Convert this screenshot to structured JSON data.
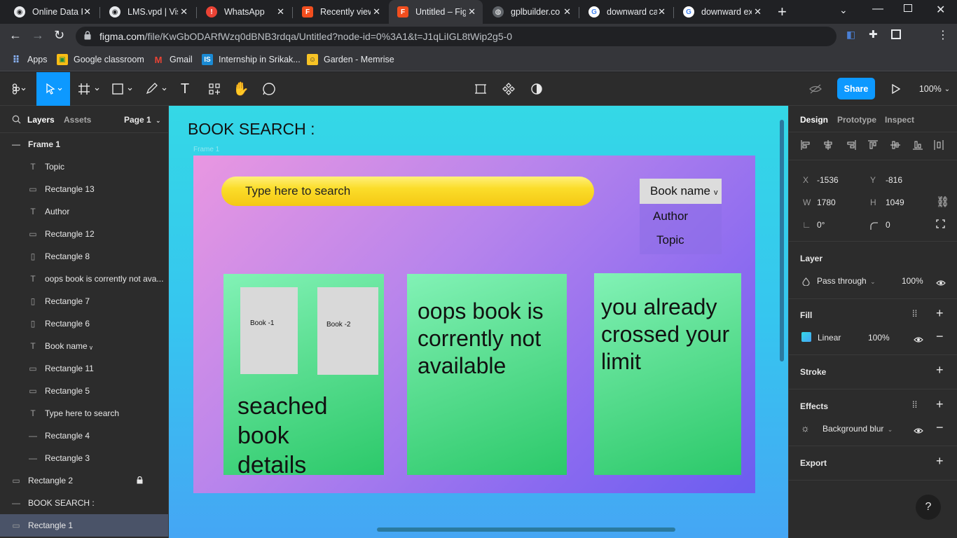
{
  "browser": {
    "tabs": [
      {
        "label": "Online Data F",
        "favicon_color": "#e8eaed"
      },
      {
        "label": "LMS.vpd | Vis",
        "favicon_color": "#e8eaed"
      },
      {
        "label": "WhatsApp",
        "favicon_color": "#ea4335"
      },
      {
        "label": "Recently view",
        "favicon_color": "#f24e1e"
      },
      {
        "label": "Untitled – Fig",
        "favicon_color": "#f24e1e"
      },
      {
        "label": "gplbuilder.co",
        "favicon_color": "#9aa0a6"
      },
      {
        "label": "downward ca",
        "favicon_color": "#4285f4"
      },
      {
        "label": "downward ex",
        "favicon_color": "#4285f4"
      }
    ],
    "new_tab_glyph": "+",
    "url_host": "figma.com",
    "url_path": "/file/KwGbODARfWzq0dBNB3rdqa/Untitled?node-id=0%3A1&t=J1qLiIGL8tWip2g5-0",
    "bookmarks": [
      {
        "label": "Apps",
        "icon": "apps-grid-icon"
      },
      {
        "label": "Google classroom",
        "icon": "classroom-icon"
      },
      {
        "label": "Gmail",
        "icon": "gmail-icon"
      },
      {
        "label": "Internship in Srikak...",
        "icon": "internshala-icon"
      },
      {
        "label": "Garden - Memrise",
        "icon": "memrise-icon"
      }
    ]
  },
  "figma": {
    "toolbar": {
      "share_label": "Share",
      "zoom_label": "100%"
    },
    "left_panel": {
      "tab_layers": "Layers",
      "tab_assets": "Assets",
      "page_label": "Page 1",
      "layers": [
        {
          "label": "Frame 1",
          "icon": "frame-collapse-icon",
          "level": 0,
          "bold": true
        },
        {
          "label": "Topic",
          "icon": "text-layer-icon",
          "level": 1
        },
        {
          "label": "Rectangle 13",
          "icon": "rectangle-layer-icon",
          "level": 1
        },
        {
          "label": "Author",
          "icon": "text-layer-icon",
          "level": 1
        },
        {
          "label": "Rectangle 12",
          "icon": "rectangle-layer-icon",
          "level": 1
        },
        {
          "label": "Rectangle 8",
          "icon": "rectangle-tall-layer-icon",
          "level": 1
        },
        {
          "label": "oops book is corrently not ava...",
          "icon": "text-layer-icon",
          "level": 1
        },
        {
          "label": "Rectangle 7",
          "icon": "rectangle-tall-layer-icon",
          "level": 1
        },
        {
          "label": "Rectangle 6",
          "icon": "rectangle-tall-layer-icon",
          "level": 1
        },
        {
          "label": "Book name ᵥ",
          "icon": "text-layer-icon",
          "level": 1
        },
        {
          "label": "Rectangle 11",
          "icon": "rectangle-layer-icon",
          "level": 1
        },
        {
          "label": "Rectangle 5",
          "icon": "rectangle-layer-icon",
          "level": 1
        },
        {
          "label": "Type here to search",
          "icon": "text-layer-icon",
          "level": 1
        },
        {
          "label": "Rectangle 4",
          "icon": "line-layer-icon",
          "level": 1
        },
        {
          "label": "Rectangle 3",
          "icon": "line-layer-icon",
          "level": 1
        },
        {
          "label": "Rectangle 2",
          "icon": "rectangle-layer-icon",
          "level": 0,
          "locked": true
        },
        {
          "label": "BOOK SEARCH :",
          "icon": "line-layer-icon",
          "level": 0
        },
        {
          "label": "Rectangle 1",
          "icon": "rectangle-layer-icon",
          "level": 0,
          "selected": true
        }
      ]
    },
    "canvas": {
      "heading": "BOOK SEARCH :",
      "frame_label": "Frame 1",
      "search_placeholder": "Type here to search",
      "dropdown": {
        "selected": "Book name",
        "caret": "v",
        "options": [
          "Author",
          "Topic"
        ]
      },
      "card1": {
        "book1": "Book -1",
        "book2": "Book -2",
        "text": "seached book details"
      },
      "card2_text": "oops book is corrently not available",
      "card3_text": "you already crossed your limit"
    },
    "right_panel": {
      "tabs": [
        "Design",
        "Prototype",
        "Inspect"
      ],
      "x_label": "X",
      "x_value": "-1536",
      "y_label": "Y",
      "y_value": "-816",
      "w_label": "W",
      "w_value": "1780",
      "h_label": "H",
      "h_value": "1049",
      "rotation_value": "0°",
      "radius_value": "0",
      "layer_title": "Layer",
      "blend_mode": "Pass through",
      "layer_opacity": "100%",
      "fill_title": "Fill",
      "fill_type": "Linear",
      "fill_opacity": "100%",
      "stroke_title": "Stroke",
      "effects_title": "Effects",
      "effect_name": "Background blur",
      "export_title": "Export",
      "help_glyph": "?"
    }
  }
}
